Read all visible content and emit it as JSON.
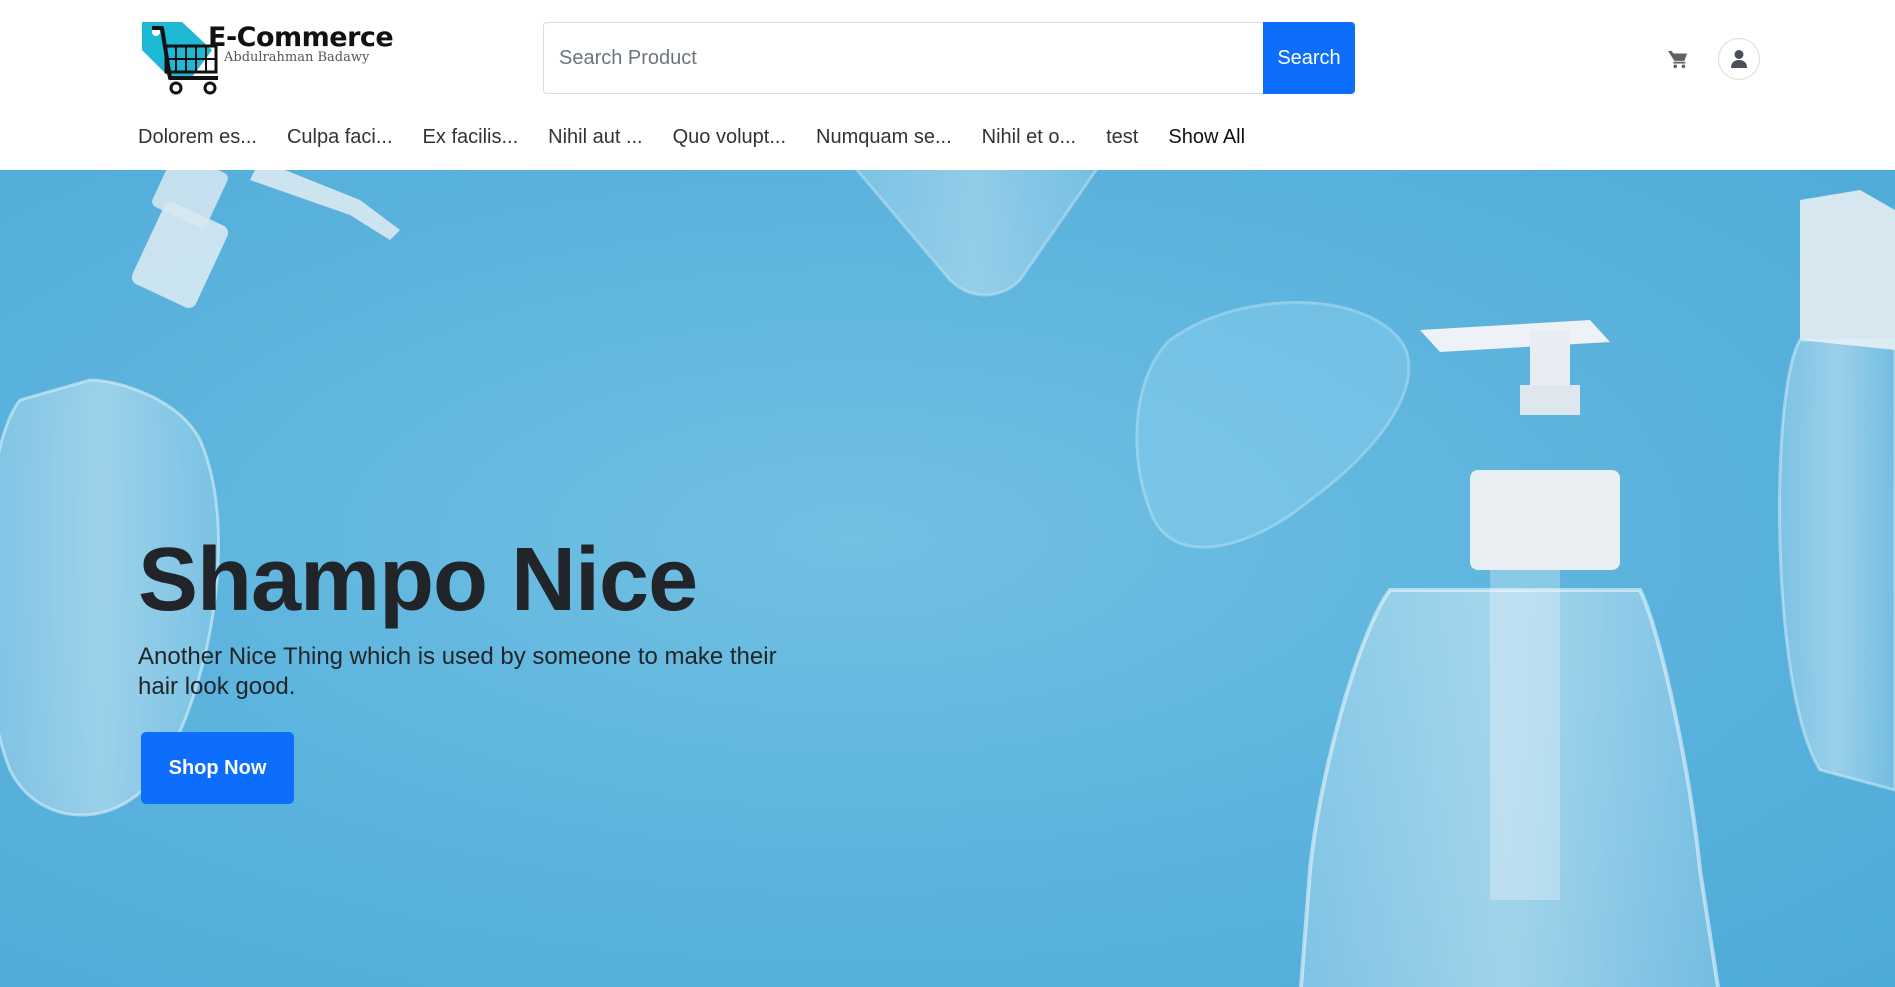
{
  "brand": {
    "title": "E-Commerce",
    "subtitle": "Abdulrahman Badawy",
    "logo_icon": "shopping-cart-tag-icon",
    "accent": "#1fb8d4"
  },
  "search": {
    "placeholder": "Search Product",
    "value": "",
    "button_label": "Search"
  },
  "header_icons": {
    "cart": "cart-icon",
    "account": "user-icon"
  },
  "categories": [
    "Dolorem es...",
    "Culpa faci...",
    "Ex facilis...",
    "Nihil aut ...",
    "Quo volupt...",
    "Numquam se...",
    "Nihil et o...",
    "test",
    "Show All"
  ],
  "hero": {
    "title": "Shampo Nice",
    "text": "Another Nice Thing which is used by someone to make their hair look good.",
    "button_label": "Shop Now"
  },
  "colors": {
    "primary": "#0d6efd",
    "hero_background": "#5eb5de",
    "text_dark": "#212529"
  }
}
